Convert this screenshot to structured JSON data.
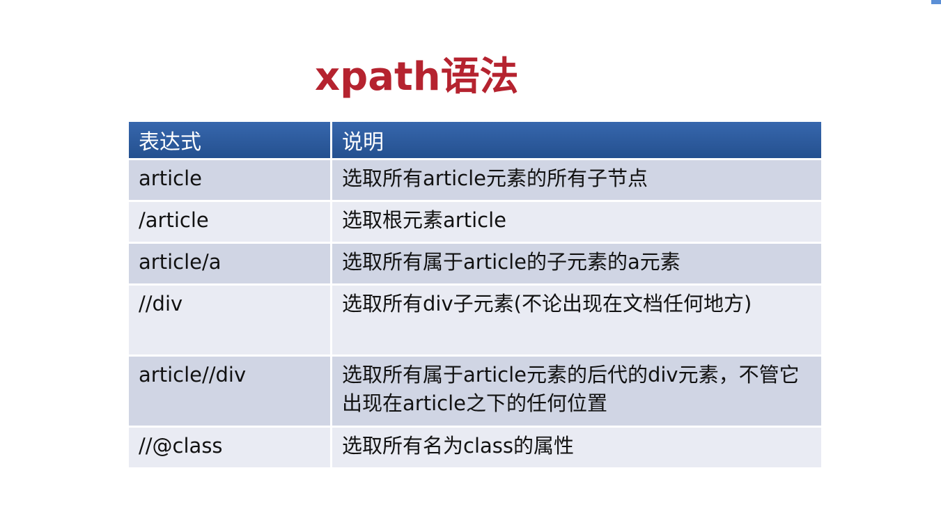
{
  "slide": {
    "title": "xpath语法"
  },
  "table": {
    "headers": [
      "表达式",
      "说明"
    ],
    "rows": [
      {
        "expr": "article",
        "desc": "选取所有article元素的所有子节点"
      },
      {
        "expr": "/article",
        "desc": "选取根元素article"
      },
      {
        "expr": "article/a",
        "desc": "选取所有属于article的子元素的a元素"
      },
      {
        "expr": "//div",
        "desc": "选取所有div子元素(不论出现在文档任何地方)"
      },
      {
        "expr": "article//div",
        "desc": "选取所有属于article元素的后代的div元素，不管它出现在article之下的任何位置"
      },
      {
        "expr": "//@class",
        "desc": "选取所有名为class的属性"
      }
    ]
  },
  "colors": {
    "title": "#b5232f",
    "header_bg": "#2e5a9e",
    "row_odd": "#d0d5e4",
    "row_even": "#e9ebf3"
  }
}
